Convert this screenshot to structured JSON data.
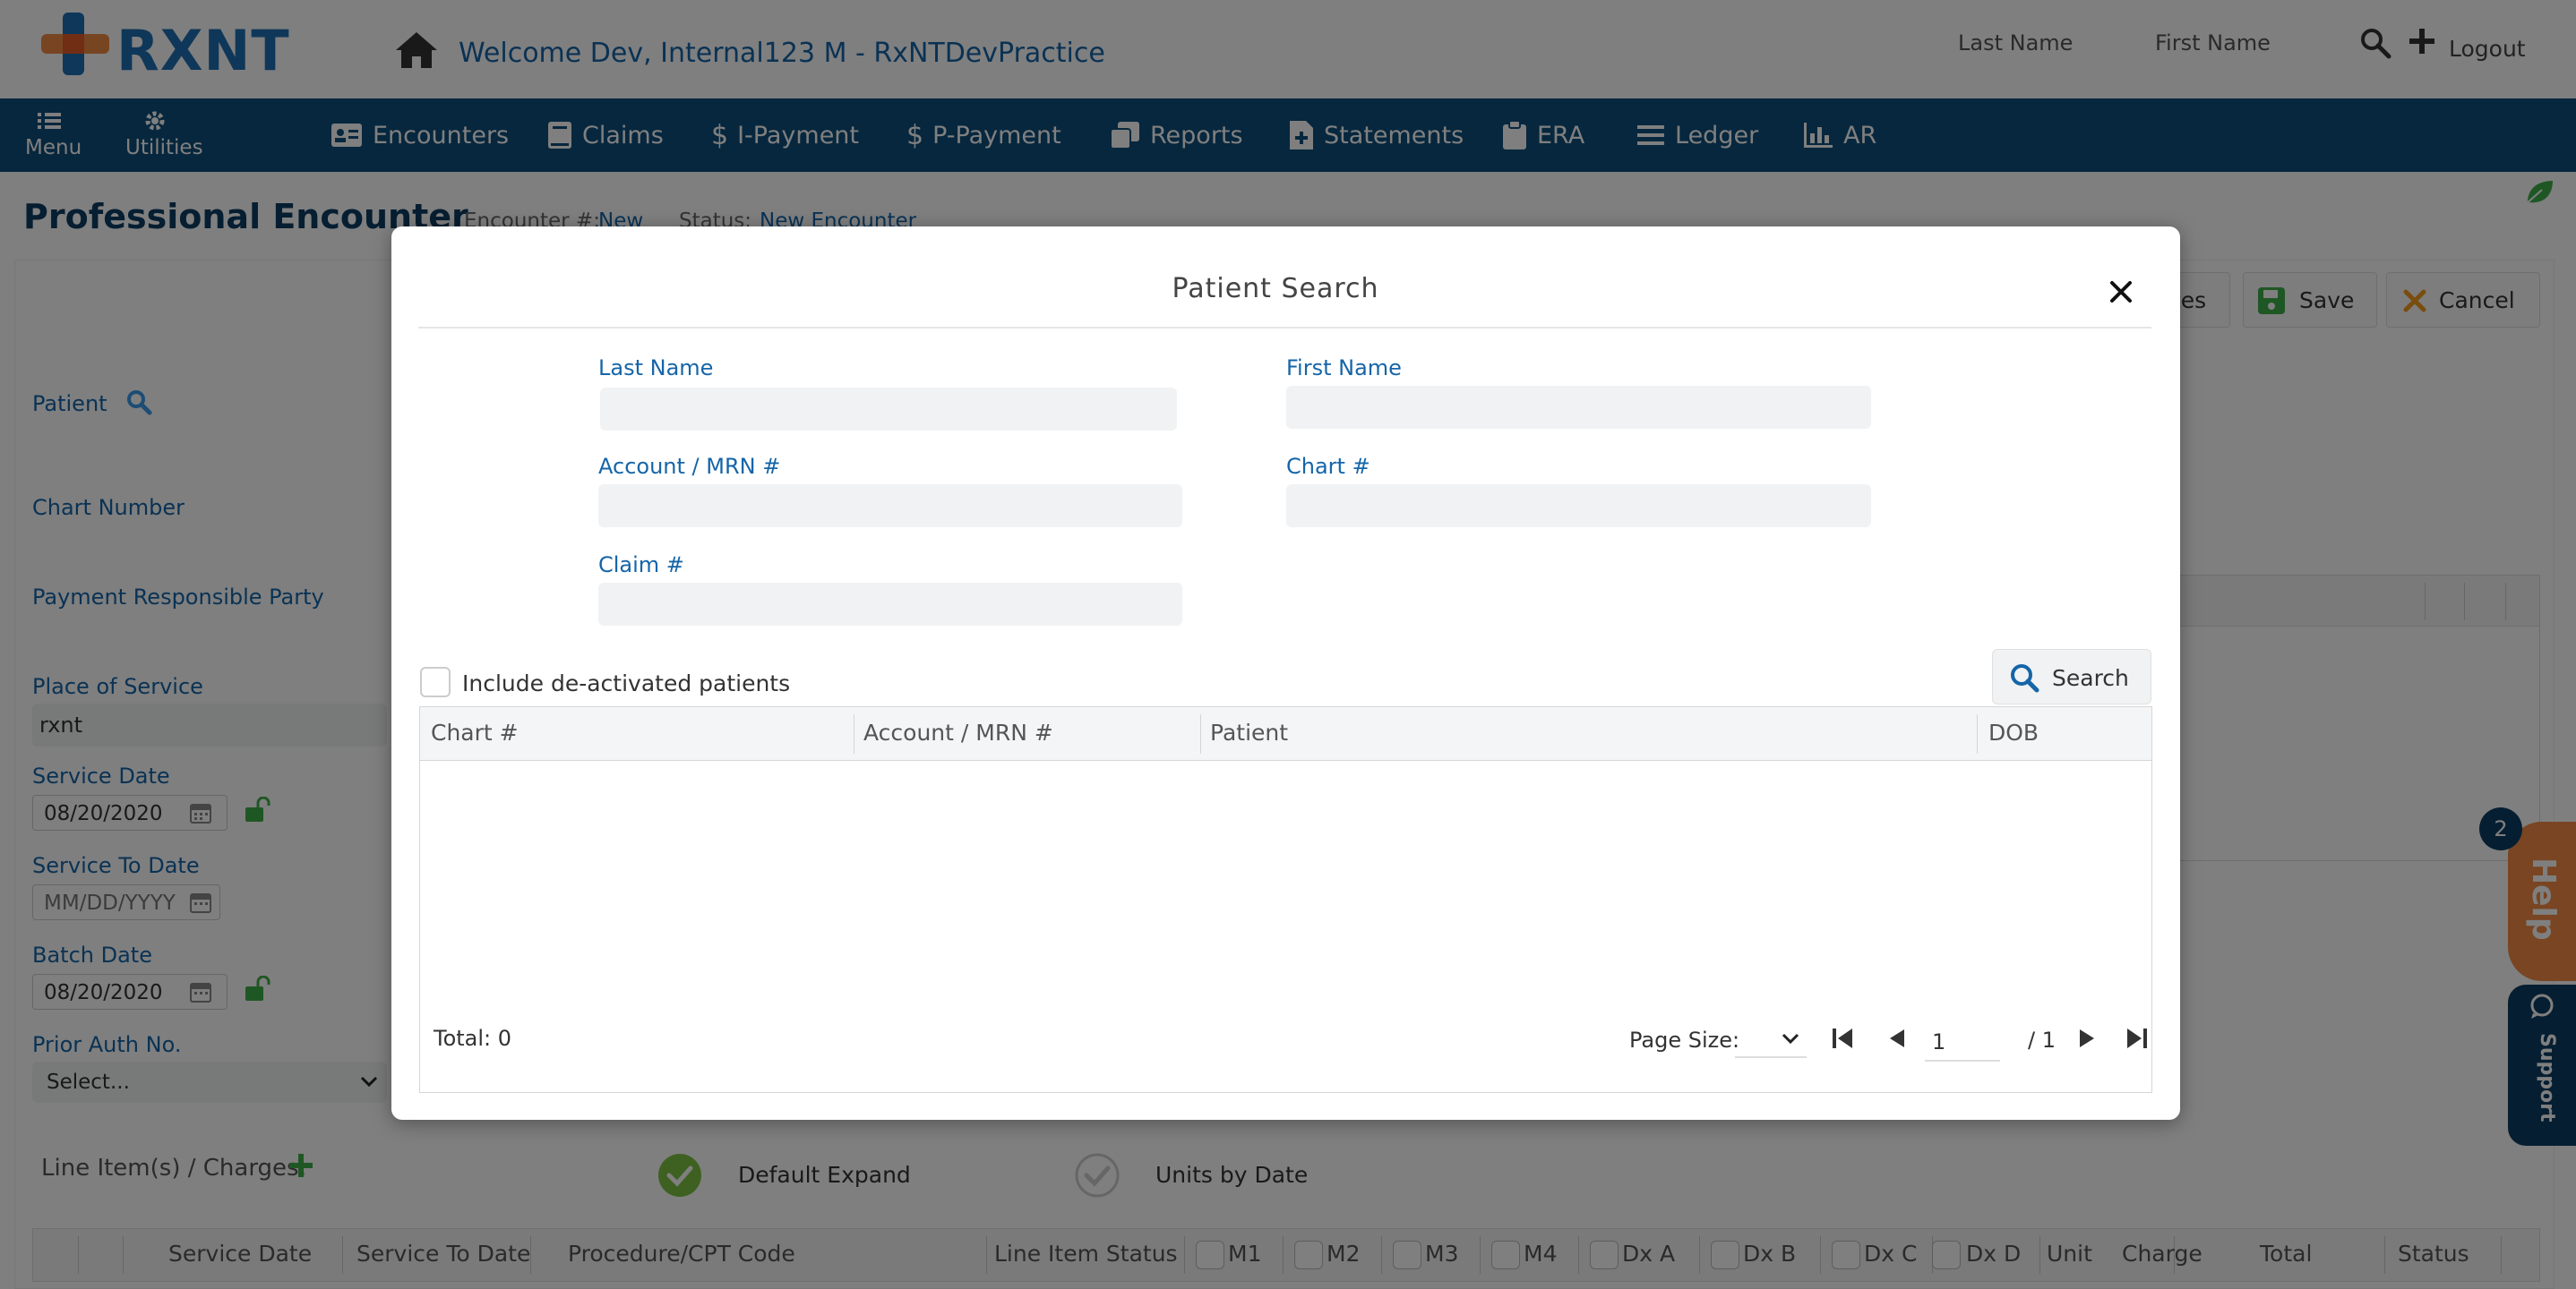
{
  "brand": {
    "logo_text": "RXNT"
  },
  "header": {
    "welcome": "Welcome Dev, Internal123 M - RxNTDevPractice",
    "last_name": "Last Name",
    "first_name": "First Name",
    "logout": "Logout"
  },
  "topnav": {
    "menu": "Menu",
    "utilities": "Utilities",
    "items": [
      {
        "label": "Encounters",
        "icon": "id-card-icon"
      },
      {
        "label": "Claims",
        "icon": "book-icon"
      },
      {
        "label": "I-Payment",
        "icon": "dollar-icon"
      },
      {
        "label": "P-Payment",
        "icon": "dollar-icon"
      },
      {
        "label": "Reports",
        "icon": "copy-icon"
      },
      {
        "label": "Statements",
        "icon": "file-plus-icon"
      },
      {
        "label": "ERA",
        "icon": "clipboard-icon"
      },
      {
        "label": "Ledger",
        "icon": "list-icon"
      },
      {
        "label": "AR",
        "icon": "bar-chart-icon"
      }
    ]
  },
  "page": {
    "title": "Professional Encounter",
    "encounter_label": "Encounter #:",
    "encounter_value": "New",
    "status_label": "Status:",
    "status_value": "New Encounter",
    "notes_partial": "tes",
    "save": "Save",
    "cancel": "Cancel"
  },
  "form": {
    "patient": "Patient",
    "chart_number": "Chart Number",
    "payment_party": "Payment Responsible Party",
    "place_of_service": "Place of Service",
    "place_of_service_value": "rxnt",
    "service_date": "Service Date",
    "service_date_value": "08/20/2020",
    "service_to_date": "Service To Date",
    "service_to_date_placeholder": "MM/DD/YYYY",
    "batch_date": "Batch Date",
    "batch_date_value": "08/20/2020",
    "prior_auth": "Prior Auth No.",
    "prior_auth_value": "Select..."
  },
  "line_items": {
    "label": "Line Item(s) / Charges:",
    "default_expand": "Default Expand",
    "units_by_date": "Units by Date",
    "columns": [
      "Service Date",
      "Service To Date",
      "Procedure/CPT Code",
      "Line Item Status",
      "M1",
      "M2",
      "M3",
      "M4",
      "Dx A",
      "Dx B",
      "Dx C",
      "Dx D",
      "Unit",
      "Charge",
      "Total",
      "Status"
    ]
  },
  "help_widget": {
    "badge": "2",
    "help": "Help",
    "support": "Support"
  },
  "modal": {
    "title": "Patient Search",
    "last_name": "Last Name",
    "first_name": "First Name",
    "account": "Account / MRN #",
    "chart": "Chart #",
    "claim": "Claim #",
    "include_deactivated": "Include de-activated patients",
    "search": "Search",
    "columns": [
      "Chart #",
      "Account / MRN #",
      "Patient",
      "DOB"
    ],
    "total": "Total: 0",
    "page_size": "Page Size:",
    "page_value": "1",
    "page_total": "/ 1"
  },
  "colors": {
    "primary": "#0d4e7c",
    "link": "#1565a8",
    "green": "#4caf50",
    "orange": "#f28a44"
  }
}
